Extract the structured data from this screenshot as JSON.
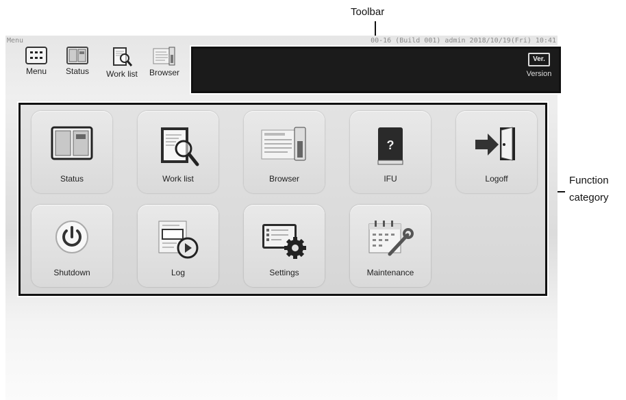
{
  "annotations": {
    "toolbar": "Toolbar",
    "function_category_line1": "Function",
    "function_category_line2": "category"
  },
  "header": {
    "title": "Menu",
    "status_info": "00-16 (Build 001) admin 2018/10/19(Fri) 10:41"
  },
  "toolbar": {
    "items": [
      {
        "label": "Menu",
        "icon": "menu-grid-icon"
      },
      {
        "label": "Status",
        "icon": "status-panel-icon"
      },
      {
        "label": "Work list",
        "icon": "worklist-clipboard-icon"
      },
      {
        "label": "Browser",
        "icon": "browser-document-icon"
      }
    ],
    "version": {
      "badge": "Ver.",
      "label": "Version"
    }
  },
  "functions": [
    {
      "label": "Status",
      "icon": "status-panel-icon"
    },
    {
      "label": "Work list",
      "icon": "worklist-clipboard-icon"
    },
    {
      "label": "Browser",
      "icon": "browser-document-icon"
    },
    {
      "label": "IFU",
      "icon": "help-book-icon"
    },
    {
      "label": "Logoff",
      "icon": "logoff-door-icon"
    },
    {
      "label": "Shutdown",
      "icon": "power-icon"
    },
    {
      "label": "Log",
      "icon": "log-clock-icon"
    },
    {
      "label": "Settings",
      "icon": "settings-gear-icon"
    },
    {
      "label": "Maintenance",
      "icon": "maintenance-calendar-icon"
    }
  ],
  "ifu_glyph": "?",
  "colors": {
    "toolbar_bg": "#1b1b1b",
    "tile_bg": "#e4e4e4"
  }
}
